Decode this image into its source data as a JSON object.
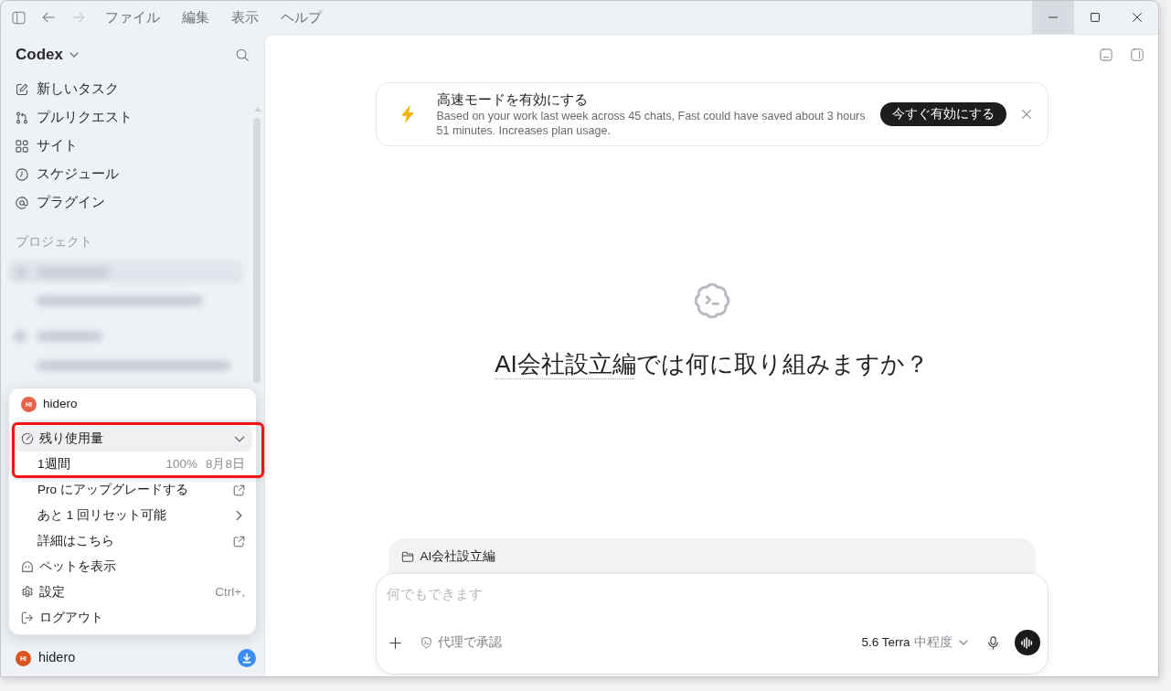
{
  "titlebar": {
    "nav": [
      {
        "kind": "back",
        "disabled": false
      },
      {
        "kind": "forward",
        "disabled": true
      }
    ],
    "menus": [
      "ファイル",
      "編集",
      "表示",
      "ヘルプ"
    ],
    "window_controls": [
      {
        "kind": "minimize",
        "hovered": true
      },
      {
        "kind": "maximize",
        "hovered": false
      },
      {
        "kind": "close",
        "hovered": false
      }
    ]
  },
  "sidebar": {
    "title": "Codex",
    "nav": [
      {
        "kind": "new-task",
        "label": "新しいタスク"
      },
      {
        "kind": "pull-requests",
        "label": "プルリクエスト"
      },
      {
        "kind": "sites",
        "label": "サイト"
      },
      {
        "kind": "schedule",
        "label": "スケジュール"
      },
      {
        "kind": "plugins",
        "label": "プラグイン"
      }
    ],
    "section_label": "プロジェクト",
    "user": {
      "initials": "HI",
      "name": "hidero"
    }
  },
  "account_menu": {
    "user": {
      "initials": "HI",
      "name": "hidero"
    },
    "items": [
      {
        "kind": "usage",
        "label": "残り使用量",
        "expanded": true,
        "highlighted": true
      },
      {
        "kind": "limit",
        "label": "1週間",
        "percent": "100%",
        "reset": "8月8日",
        "highlighted": true
      },
      {
        "kind": "external",
        "label": "Pro にアップグレードする",
        "highlighted": false
      },
      {
        "kind": "submenu",
        "label": "あと 1 回リセット可能",
        "highlighted": false
      },
      {
        "kind": "external",
        "label": "詳細はこちら",
        "highlighted": false
      },
      {
        "kind": "pet",
        "label": "ペットを表示",
        "highlighted": false
      },
      {
        "kind": "settings",
        "label": "設定",
        "shortcut": "Ctrl+,",
        "highlighted": false
      },
      {
        "kind": "logout",
        "label": "ログアウト",
        "highlighted": false
      }
    ]
  },
  "banner": {
    "title": "高速モードを有効にする",
    "text": "Based on your work last week across 45 chats, Fast could have saved about 3 hours 51 minutes. Increases plan usage.",
    "button": "今すぐ有効にする"
  },
  "prompt": {
    "project": "AI会社設立編",
    "question": "では何に取り組みますか？"
  },
  "composer": {
    "project": "AI会社設立編",
    "placeholder": "何でもできます",
    "approval": "代理で承認",
    "model": "5.6 Terra",
    "effort": "中程度"
  }
}
